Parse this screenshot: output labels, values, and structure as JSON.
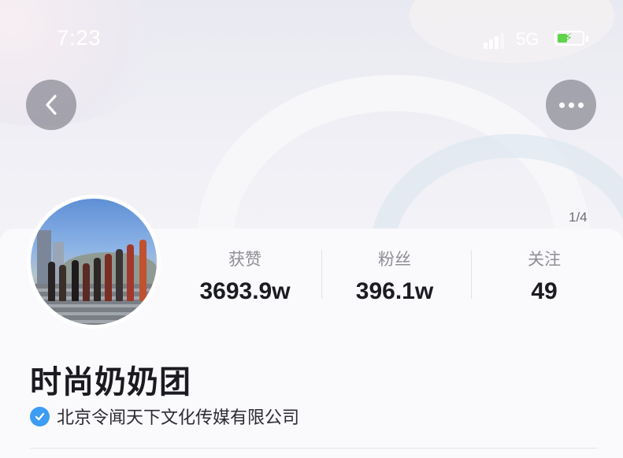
{
  "status_bar": {
    "time": "7:23",
    "network": "5G",
    "battery_color": "#5fd34a"
  },
  "header": {
    "back_icon": "chevron-left-icon",
    "more_icon": "ellipsis-icon",
    "page_indicator": "1/4"
  },
  "profile": {
    "name": "时尚奶奶团",
    "verification_text": "北京令闻天下文化传媒有限公司",
    "verified_badge_color": "#3d9cf3"
  },
  "stats": [
    {
      "label": "获赞",
      "value": "3693.9w"
    },
    {
      "label": "粉丝",
      "value": "396.1w"
    },
    {
      "label": "关注",
      "value": "49"
    }
  ]
}
